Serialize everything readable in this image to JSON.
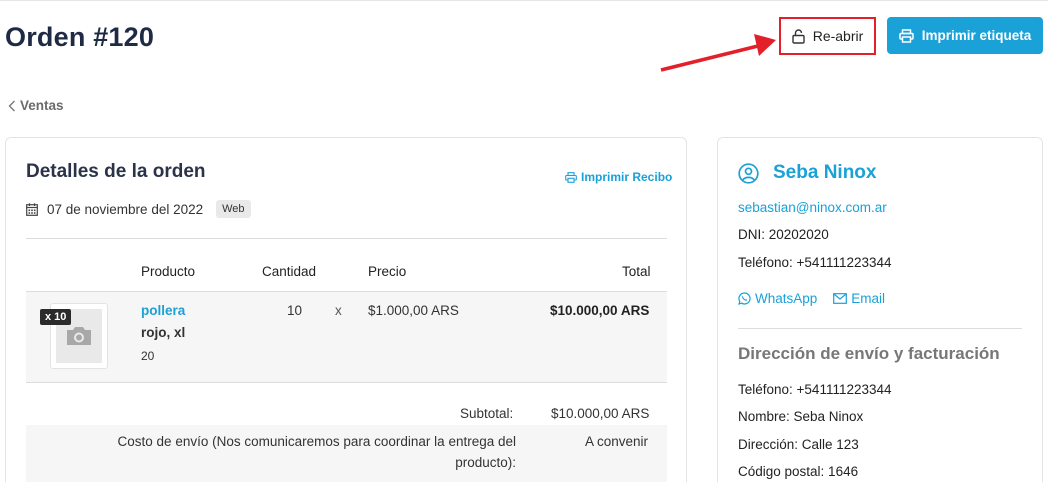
{
  "page": {
    "title": "Orden #120",
    "breadcrumb": "Ventas"
  },
  "actions": {
    "reopen_label": "Re-abrir",
    "print_label_label": "Imprimir etiqueta"
  },
  "details": {
    "heading": "Detalles de la orden",
    "print_receipt": "Imprimir Recibo",
    "date": "07 de noviembre del 2022",
    "channel_badge": "Web",
    "columns": {
      "product": "Producto",
      "quantity": "Cantidad",
      "price": "Precio",
      "total": "Total"
    },
    "items": [
      {
        "qty_badge": "x 10",
        "name": "pollera",
        "variant": "rojo, xl",
        "sku": "20",
        "quantity": "10",
        "times": "x",
        "price": "$1.000,00 ARS",
        "total": "$10.000,00 ARS"
      }
    ],
    "subtotal_label": "Subtotal:",
    "subtotal_value": "$10.000,00 ARS",
    "shipping_label_line1": "Costo de envío (Nos comunicaremos para coordinar la entrega del",
    "shipping_label_line2": "producto):",
    "shipping_value": "A convenir"
  },
  "customer": {
    "name": "Seba Ninox",
    "email": "sebastian@ninox.com.ar",
    "dni": "DNI: 20202020",
    "phone": "Teléfono: +541111223344",
    "whatsapp": "WhatsApp",
    "email_link": "Email",
    "address_heading": "Dirección de envío y facturación",
    "addr_phone": "Teléfono: +541111223344",
    "addr_name": "Nombre: Seba Ninox",
    "addr_street": "Dirección: Calle 123",
    "addr_zip": "Código postal: 1646"
  },
  "colors": {
    "accent": "#1aa1d8",
    "highlight": "#e3202a",
    "title": "#1f2a44"
  }
}
